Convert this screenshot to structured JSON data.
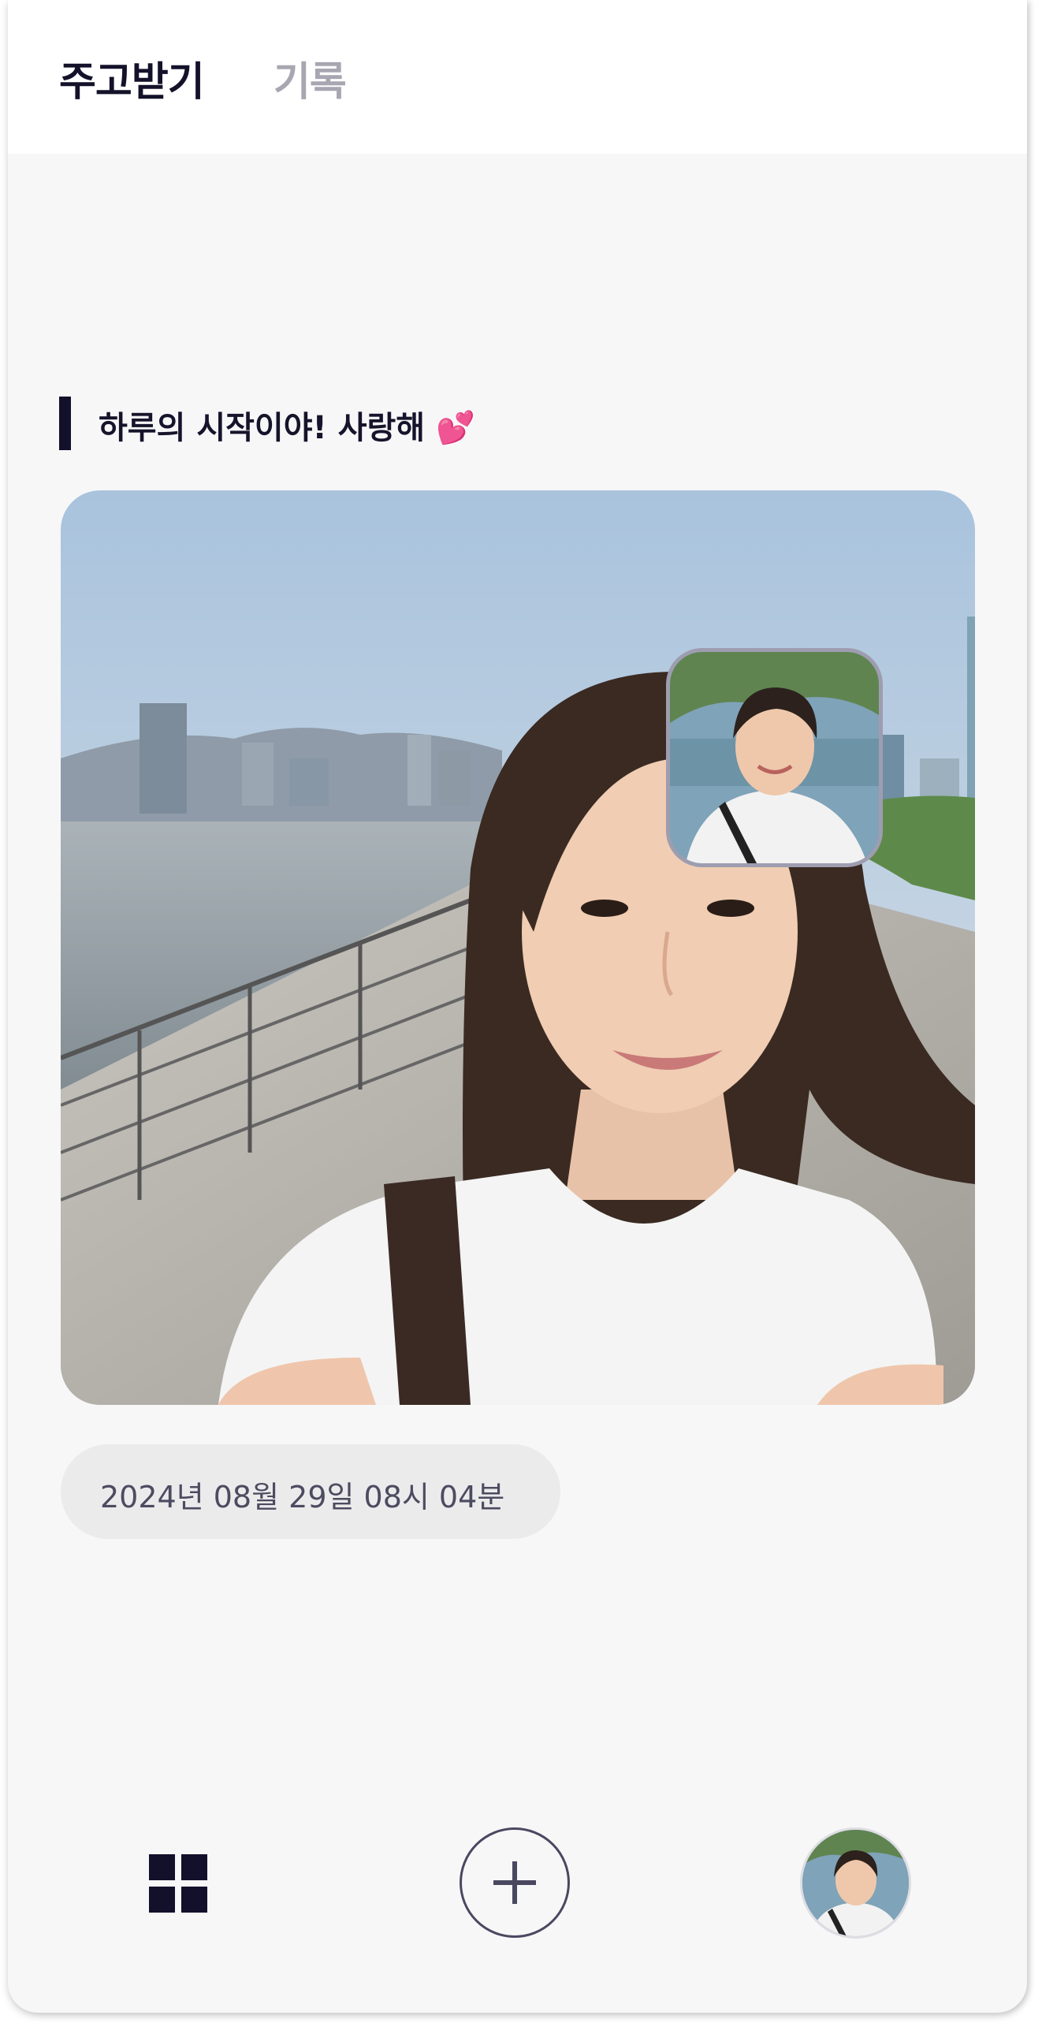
{
  "header": {
    "tabs": [
      {
        "label": "주고받기",
        "active": true
      },
      {
        "label": "기록",
        "active": false
      }
    ]
  },
  "post": {
    "message": "하루의 시작이야! 사랑해 💕",
    "timestamp": "2024년 08월 29일 08시 04분"
  },
  "bottom_nav": {
    "icons": [
      "grid-icon",
      "plus-icon",
      "avatar"
    ]
  },
  "colors": {
    "accent": "#12102b",
    "inactive_tab": "#a7a6b1",
    "pill_bg": "#ebebec",
    "page_bg": "#f7f7f8"
  }
}
